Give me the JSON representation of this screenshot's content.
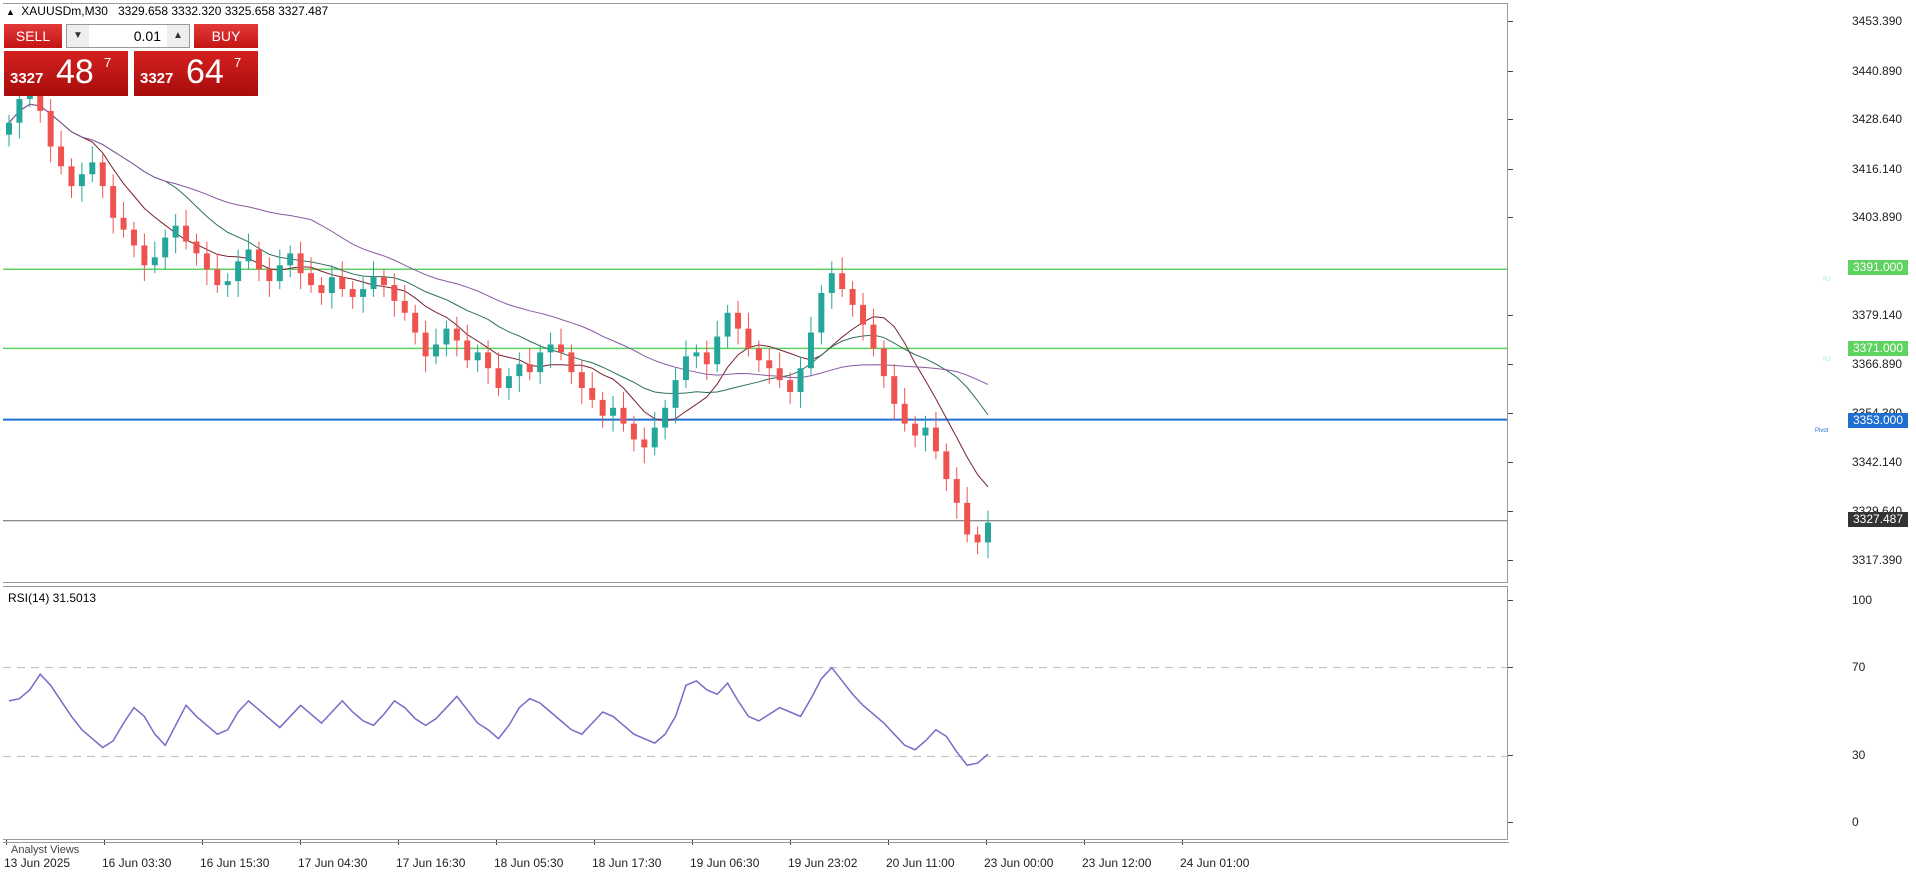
{
  "header": {
    "symbol": "XAUUSDm,M30",
    "ohlc": "3329.658 3332.320 3325.658 3327.487"
  },
  "trade_panel": {
    "sell_label": "SELL",
    "buy_label": "BUY",
    "volume": "0.01",
    "sell_small": "3327",
    "sell_big": "48",
    "sell_sup": "7",
    "buy_small": "3327",
    "buy_big": "64",
    "buy_sup": "7"
  },
  "price_axis": [
    "3453.390",
    "3440.890",
    "3428.640",
    "3416.140",
    "3403.890",
    "3379.140",
    "3366.890",
    "3354.390",
    "3342.140",
    "3329.640",
    "3317.390"
  ],
  "price_tags": {
    "r1": "3391.000",
    "r2": "3371.000",
    "pivot": "3353.000",
    "current": "3327.487"
  },
  "level_notes": {
    "r1": "R1",
    "r2": "R2",
    "pivot": "Pivot"
  },
  "rsi": {
    "header": "RSI(14) 31.5013",
    "axis": [
      "100",
      "70",
      "30",
      "0"
    ]
  },
  "time_axis": [
    "13 Jun 2025",
    "16 Jun 03:30",
    "16 Jun 15:30",
    "17 Jun 04:30",
    "17 Jun 16:30",
    "18 Jun 05:30",
    "18 Jun 17:30",
    "19 Jun 06:30",
    "19 Jun 23:02",
    "20 Jun 11:00",
    "23 Jun 00:00",
    "23 Jun 12:00",
    "24 Jun 01:00"
  ],
  "bottom_tab": "Analyst Views",
  "colors": {
    "bull": "#26a69a",
    "bear": "#ef5350",
    "resistance": "#5fd35f",
    "pivot": "#1f6fd0",
    "rsi": "#7b68c8",
    "ma1": "#7b2030",
    "ma2": "#2f6f5a",
    "ma3": "#8a5aa0"
  },
  "chart_data": {
    "type": "candlestick",
    "symbol": "XAUUSDm",
    "timeframe": "M30",
    "ylim": [
      3312,
      3458
    ],
    "close_series": [
      3428,
      3434,
      3436,
      3431,
      3422,
      3417,
      3412,
      3415,
      3418,
      3412,
      3404,
      3401,
      3397,
      3392,
      3394,
      3399,
      3402,
      3398,
      3395,
      3391,
      3387,
      3388,
      3393,
      3396,
      3391,
      3388,
      3392,
      3395,
      3390,
      3387,
      3385,
      3389,
      3386,
      3384,
      3386,
      3389,
      3387,
      3383,
      3380,
      3375,
      3369,
      3372,
      3376,
      3373,
      3368,
      3370,
      3366,
      3361,
      3364,
      3367,
      3365,
      3370,
      3372,
      3370,
      3365,
      3361,
      3358,
      3354,
      3356,
      3352,
      3348,
      3346,
      3351,
      3356,
      3363,
      3369,
      3370,
      3367,
      3374,
      3380,
      3376,
      3371,
      3368,
      3366,
      3363,
      3360,
      3366,
      3375,
      3385,
      3390,
      3386,
      3382,
      3377,
      3371,
      3364,
      3357,
      3352,
      3349,
      3351,
      3345,
      3338,
      3332,
      3324,
      3322,
      3327
    ],
    "levels": [
      3391.0,
      3371.0,
      3353.0
    ],
    "current_price": 3327.487,
    "rsi_series": [
      55,
      56,
      60,
      67,
      62,
      55,
      48,
      42,
      38,
      34,
      37,
      45,
      52,
      48,
      40,
      35,
      44,
      53,
      48,
      44,
      40,
      42,
      50,
      55,
      51,
      47,
      43,
      48,
      53,
      49,
      45,
      50,
      55,
      50,
      46,
      44,
      49,
      55,
      52,
      47,
      44,
      47,
      52,
      57,
      51,
      45,
      42,
      38,
      44,
      52,
      56,
      54,
      50,
      46,
      42,
      40,
      45,
      50,
      48,
      44,
      40,
      38,
      36,
      40,
      48,
      62,
      64,
      60,
      58,
      63,
      55,
      48,
      46,
      49,
      52,
      50,
      48,
      56,
      65,
      70,
      64,
      58,
      53,
      49,
      45,
      40,
      35,
      33,
      37,
      42,
      39,
      32,
      26,
      27,
      31
    ],
    "rsi_levels": [
      70,
      30
    ],
    "rsi_range": [
      0,
      100
    ]
  }
}
